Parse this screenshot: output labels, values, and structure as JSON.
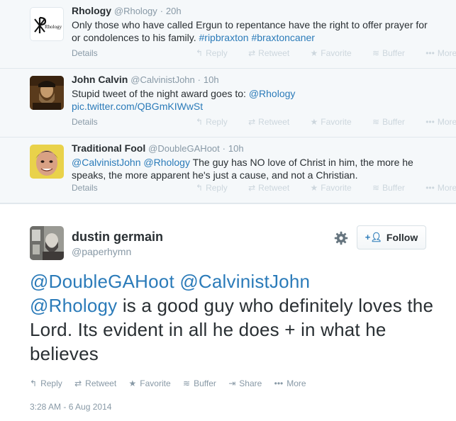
{
  "tweets": [
    {
      "name": "Rhology",
      "handle": "@Rhology",
      "time": "20h",
      "text_plain": "Only those who have called Ergun to repentance have the right to offer prayer for or condolences to his family. ",
      "link1": "#ripbraxton",
      "link2": "#braxtoncaner",
      "details": "Details"
    },
    {
      "name": "John Calvin",
      "handle": "@CalvinistJohn",
      "time": "10h",
      "text_plain": "Stupid tweet of the night award goes to: ",
      "link1": "@Rhology",
      "link2": "pic.twitter.com/QBGmKIWwSt",
      "details": "Details"
    },
    {
      "name": "Traditional Fool",
      "handle": "@DoubleGAHoot",
      "time": "10h",
      "link1": "@CalvinistJohn",
      "link2": "@Rhology",
      "text_plain": " The guy has NO love of Christ in him, the more he speaks, the more apparent he's just a cause, and not a Christian.",
      "details": "Details"
    }
  ],
  "faint_actions": {
    "reply": "Reply",
    "retweet": "Retweet",
    "favorite": "Favorite",
    "buffer": "Buffer",
    "more": "More"
  },
  "main": {
    "name": "dustin germain",
    "handle": "@paperhymn",
    "follow_label": "Follow",
    "mention1": "@DoubleGAHoot",
    "mention2": "@CalvinistJohn",
    "mention3": "@Rhology",
    "text_plain": " is a good guy who definitely loves the Lord. Its evident in all he does + in what he believes",
    "actions": {
      "reply": "Reply",
      "retweet": "Retweet",
      "favorite": "Favorite",
      "buffer": "Buffer",
      "share": "Share",
      "more": "More"
    },
    "date": "3:28 AM - 6 Aug 2014"
  },
  "colors": {
    "link": "#2b7bb9",
    "muted": "#8899a6",
    "faint": "#ccd6dd",
    "convo_bg": "#f5f8fa"
  }
}
